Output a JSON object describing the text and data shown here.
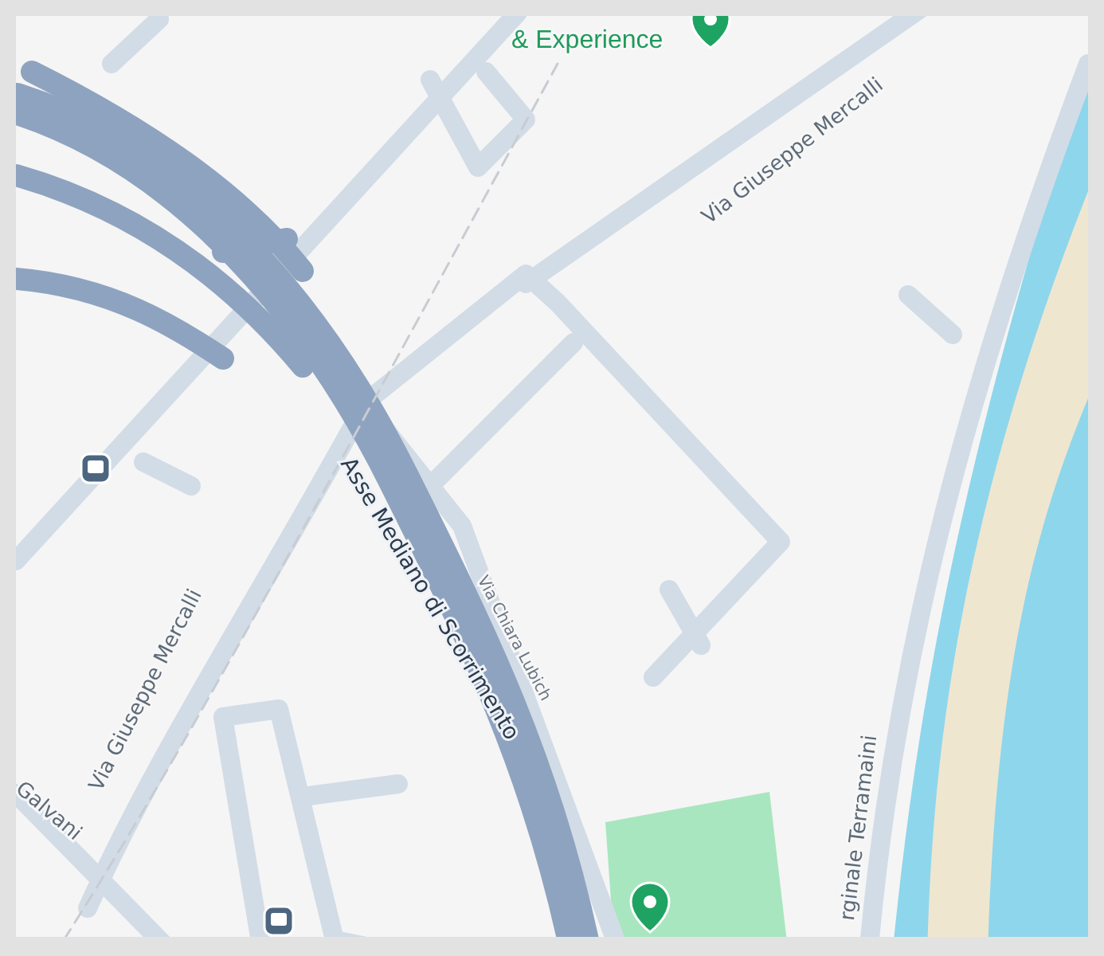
{
  "map": {
    "labels": [
      {
        "text": "& Experience",
        "kind": "poi"
      },
      {
        "text": "Via Giuseppe Mercalli",
        "kind": "street"
      },
      {
        "text": "Asse Mediano di Scorrimento",
        "kind": "highway"
      },
      {
        "text": "Via Chiara Lubich",
        "kind": "minor"
      },
      {
        "text": "Via Giuseppe Mercalli",
        "kind": "street"
      },
      {
        "text": "Galvani",
        "kind": "street"
      },
      {
        "text": "rginale Terramaini",
        "kind": "street"
      }
    ]
  }
}
